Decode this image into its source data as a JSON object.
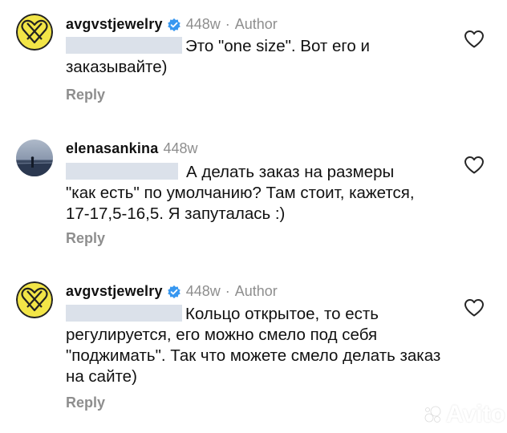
{
  "comments": [
    {
      "username": "avgvstjewelry",
      "verified": true,
      "age": "448w",
      "author_badge": "Author",
      "text": "Это \"one size\". Вот его и заказывайте)",
      "reply_label": "Reply"
    },
    {
      "username": "elenasankina",
      "verified": false,
      "age": "448w",
      "text": "А делать заказ на размеры \"как есть\" по умолчанию? Там стоит, кажется, 17-17,5-16,5. Я запуталась :)",
      "reply_label": "Reply"
    },
    {
      "username": "avgvstjewelry",
      "verified": true,
      "age": "448w",
      "author_badge": "Author",
      "text": "Кольцо открытое, то есть регулируется, его можно смело под себя \"поджимать\". Так что можете смело делать заказ на сайте)",
      "reply_label": "Reply"
    }
  ],
  "watermark": {
    "text": "Avito"
  },
  "icons": {
    "like": "heart-outline-icon",
    "verified": "verified-badge-icon",
    "brand_avatar": "heart-knot-logo"
  },
  "colors": {
    "verified_blue": "#3797f0",
    "avatar_yellow": "#f2e547",
    "meta_gray": "#8e8e8e",
    "mention_blur": "#dbe1ea"
  }
}
